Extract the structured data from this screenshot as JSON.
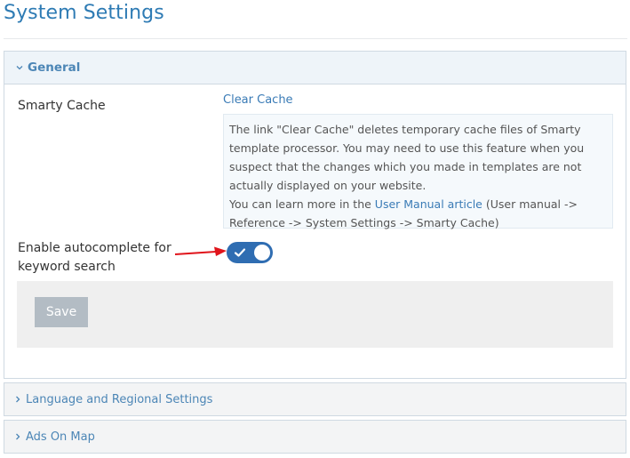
{
  "page": {
    "title": "System Settings"
  },
  "panels": {
    "general": {
      "title": "General",
      "expanded": true,
      "chevron_icon": "chevron-down-icon",
      "smarty_cache": {
        "label": "Smarty Cache",
        "link_label": "Clear Cache",
        "help_text_1": "The link \"Clear Cache\" deletes temporary cache files of Smarty template processor. You may need to use this feature when you suspect that the changes which you made in templates are not actually displayed on your website.",
        "help_text_2_prefix": "You can learn more in the ",
        "help_link_label": "User Manual article",
        "help_text_2_suffix": " (User manual -> Reference -> System Settings -> Smarty Cache)"
      },
      "autocomplete": {
        "label": "Enable autocomplete for keyword search",
        "enabled": true,
        "toggle_color": "#2f6db2",
        "check_icon": "check-icon"
      },
      "save_label": "Save"
    },
    "language": {
      "title": "Language and Regional Settings",
      "expanded": false,
      "chevron_icon": "chevron-right-icon"
    },
    "ads_on_map": {
      "title": "Ads On Map",
      "expanded": false,
      "chevron_icon": "chevron-right-icon"
    }
  },
  "annotation": {
    "arrow_color": "#e0141b",
    "arrow_icon": "red-arrow-icon"
  },
  "colors": {
    "accent": "#2e7bb4",
    "link": "#3a7bb6",
    "panel_header_bg": "#eef4f9",
    "save_button_bg": "#b3bcc4"
  }
}
